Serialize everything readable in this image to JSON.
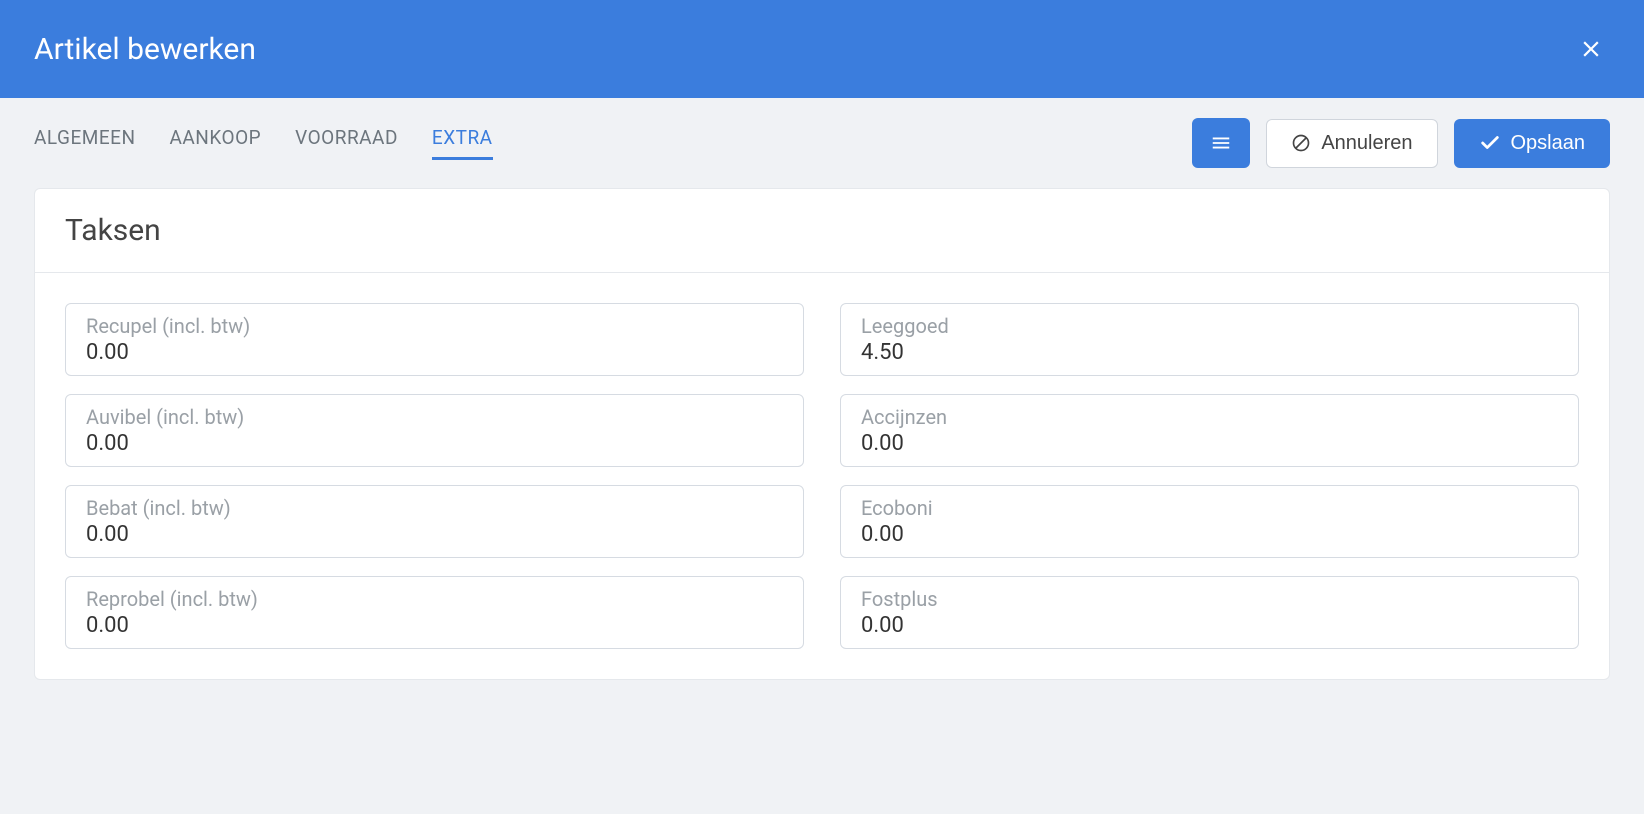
{
  "header": {
    "title": "Artikel bewerken"
  },
  "tabs": {
    "algemeen": "ALGEMEEN",
    "aankoop": "AANKOOP",
    "voorraad": "VOORRAAD",
    "extra": "EXTRA"
  },
  "actions": {
    "cancel": "Annuleren",
    "save": "Opslaan"
  },
  "panel": {
    "title": "Taksen"
  },
  "fields": {
    "recupel": {
      "label": "Recupel (incl. btw)",
      "value": "0.00"
    },
    "leeggoed": {
      "label": "Leeggoed",
      "value": "4.50"
    },
    "auvibel": {
      "label": "Auvibel (incl. btw)",
      "value": "0.00"
    },
    "accijnzen": {
      "label": "Accijnzen",
      "value": "0.00"
    },
    "bebat": {
      "label": "Bebat (incl. btw)",
      "value": "0.00"
    },
    "ecoboni": {
      "label": "Ecoboni",
      "value": "0.00"
    },
    "reprobel": {
      "label": "Reprobel (incl. btw)",
      "value": "0.00"
    },
    "fostplus": {
      "label": "Fostplus",
      "value": "0.00"
    }
  }
}
